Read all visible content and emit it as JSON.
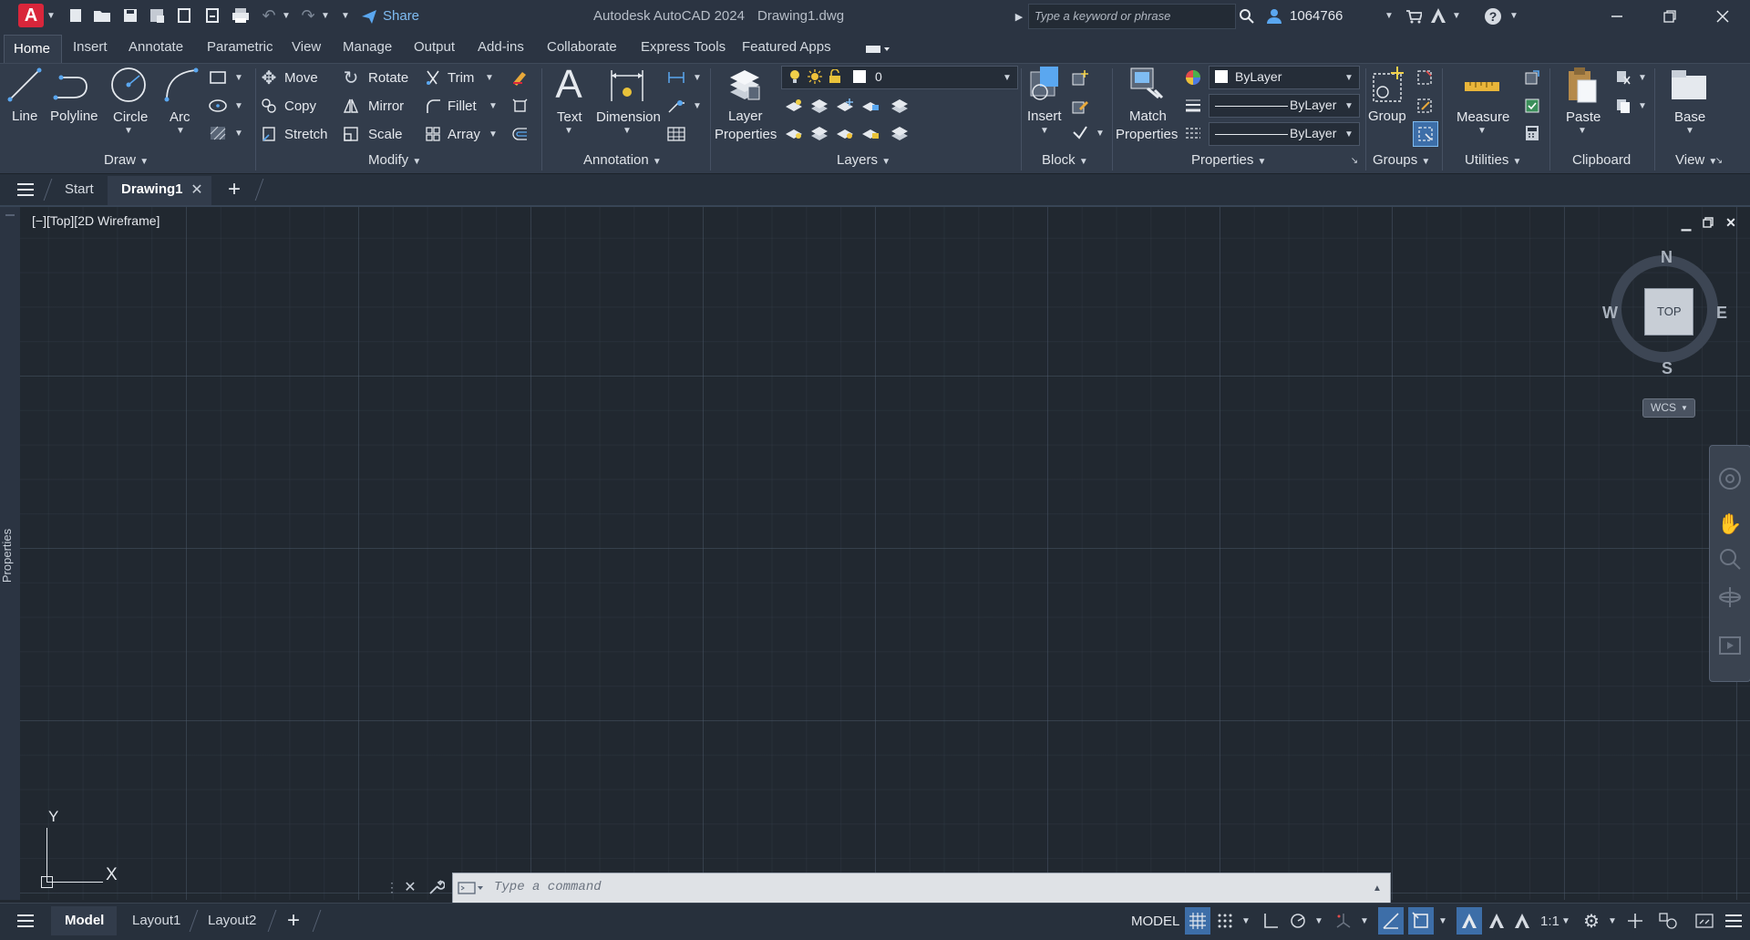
{
  "titlebar": {
    "logo": "A",
    "share": "Share",
    "app_title": "Autodesk AutoCAD 2024",
    "file_title": "Drawing1.dwg",
    "search_placeholder": "Type a keyword or phrase",
    "user": "1064766"
  },
  "ribbon_tabs": [
    "Home",
    "Insert",
    "Annotate",
    "Parametric",
    "View",
    "Manage",
    "Output",
    "Add-ins",
    "Collaborate",
    "Express Tools",
    "Featured Apps"
  ],
  "ribbon": {
    "draw": {
      "line": "Line",
      "polyline": "Polyline",
      "circle": "Circle",
      "arc": "Arc",
      "label": "Draw"
    },
    "modify": {
      "move": "Move",
      "rotate": "Rotate",
      "trim": "Trim",
      "copy": "Copy",
      "mirror": "Mirror",
      "fillet": "Fillet",
      "stretch": "Stretch",
      "scale": "Scale",
      "array": "Array",
      "label": "Modify"
    },
    "annotation": {
      "text": "Text",
      "dimension": "Dimension",
      "label": "Annotation"
    },
    "layers": {
      "layer_props_1": "Layer",
      "layer_props_2": "Properties",
      "current_layer": "0",
      "label": "Layers"
    },
    "block": {
      "insert": "Insert",
      "label": "Block"
    },
    "properties": {
      "match_1": "Match",
      "match_2": "Properties",
      "color": "ByLayer",
      "linetype": "ByLayer",
      "lineweight": "ByLayer",
      "label": "Properties"
    },
    "groups": {
      "group": "Group",
      "label": "Groups"
    },
    "utilities": {
      "measure": "Measure",
      "label": "Utilities"
    },
    "clipboard": {
      "paste": "Paste",
      "label": "Clipboard"
    },
    "view": {
      "base": "Base",
      "label": "View"
    }
  },
  "file_tabs": {
    "start": "Start",
    "drawing": "Drawing1"
  },
  "viewport": {
    "label": "[−][Top][2D Wireframe]",
    "properties_side": "Properties",
    "viewcube": {
      "n": "N",
      "s": "S",
      "e": "E",
      "w": "W",
      "top": "TOP",
      "wcs": "WCS"
    },
    "ucs": {
      "x": "X",
      "y": "Y"
    },
    "command_placeholder": "Type a command"
  },
  "layout_tabs": [
    "Model",
    "Layout1",
    "Layout2"
  ],
  "status": {
    "model": "MODEL",
    "scale": "1:1"
  },
  "colors": {
    "accent": "#2e8be6",
    "logo_red": "#d9263b",
    "ribbon_bg": "#323c4b",
    "canvas_bg": "#212830"
  }
}
